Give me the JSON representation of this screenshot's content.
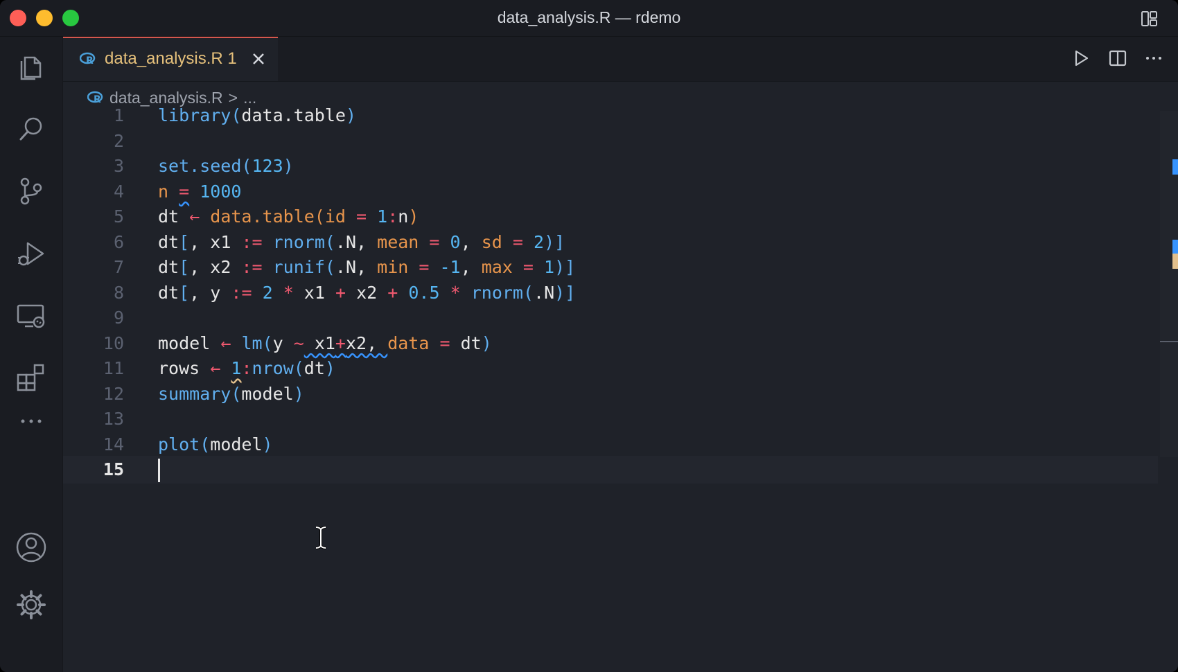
{
  "window": {
    "title": "data_analysis.R — rdemo"
  },
  "activity_bar": {
    "items": [
      "explorer-icon",
      "search-icon",
      "source-control-icon",
      "run-debug-icon",
      "remote-explorer-icon",
      "extensions-icon",
      "more-icon",
      "account-icon",
      "settings-gear-icon"
    ]
  },
  "tab": {
    "label": "data_analysis.R 1",
    "close_icon": "close-icon",
    "accent": "#e5c07b"
  },
  "tab_actions": [
    "run-icon",
    "split-editor-icon",
    "more-actions-icon"
  ],
  "breadcrumb": {
    "file": "data_analysis.R",
    "separator": ">",
    "rest": "..."
  },
  "editor": {
    "current_line": "15",
    "lines": [
      {
        "n": "1"
      },
      {
        "n": "2"
      },
      {
        "n": "3"
      },
      {
        "n": "4"
      },
      {
        "n": "5"
      },
      {
        "n": "6"
      },
      {
        "n": "7"
      },
      {
        "n": "8"
      },
      {
        "n": "9"
      },
      {
        "n": "10"
      },
      {
        "n": "11"
      },
      {
        "n": "12"
      },
      {
        "n": "13"
      },
      {
        "n": "14"
      },
      {
        "n": "15"
      }
    ],
    "code": [
      [
        [
          "fn",
          "library("
        ],
        [
          "id",
          "data.table"
        ],
        [
          "fn",
          ")"
        ]
      ],
      [],
      [
        [
          "fn",
          "set.seed("
        ],
        [
          "num",
          "123"
        ],
        [
          "fn",
          ")"
        ]
      ],
      [
        [
          "var",
          "n "
        ],
        [
          "op",
          "="
        ],
        [
          "id",
          " "
        ],
        [
          "num",
          "1000"
        ]
      ],
      [
        [
          "id",
          "dt "
        ],
        [
          "op",
          "←"
        ],
        [
          "id",
          " "
        ],
        [
          "arg",
          "data.table("
        ],
        [
          "arg",
          "id"
        ],
        [
          "id",
          " "
        ],
        [
          "op",
          "="
        ],
        [
          "id",
          " "
        ],
        [
          "num",
          "1"
        ],
        [
          "op",
          ":"
        ],
        [
          "id",
          "n"
        ],
        [
          "arg",
          ")"
        ]
      ],
      [
        [
          "id",
          "dt"
        ],
        [
          "fn",
          "["
        ],
        [
          "id",
          ", x1 "
        ],
        [
          "op",
          ":="
        ],
        [
          "id",
          " "
        ],
        [
          "fn",
          "rnorm("
        ],
        [
          "id",
          ".N, "
        ],
        [
          "arg",
          "mean"
        ],
        [
          "id",
          " "
        ],
        [
          "op",
          "="
        ],
        [
          "id",
          " "
        ],
        [
          "num",
          "0"
        ],
        [
          "id",
          ", "
        ],
        [
          "arg",
          "sd"
        ],
        [
          "id",
          " "
        ],
        [
          "op",
          "="
        ],
        [
          "id",
          " "
        ],
        [
          "num",
          "2"
        ],
        [
          "fn",
          ")]"
        ]
      ],
      [
        [
          "id",
          "dt"
        ],
        [
          "fn",
          "["
        ],
        [
          "id",
          ", x2 "
        ],
        [
          "op",
          ":="
        ],
        [
          "id",
          " "
        ],
        [
          "fn",
          "runif("
        ],
        [
          "id",
          ".N, "
        ],
        [
          "arg",
          "min"
        ],
        [
          "id",
          " "
        ],
        [
          "op",
          "="
        ],
        [
          "id",
          " "
        ],
        [
          "num",
          "-1"
        ],
        [
          "id",
          ", "
        ],
        [
          "arg",
          "max"
        ],
        [
          "id",
          " "
        ],
        [
          "op",
          "="
        ],
        [
          "id",
          " "
        ],
        [
          "num",
          "1"
        ],
        [
          "fn",
          ")]"
        ]
      ],
      [
        [
          "id",
          "dt"
        ],
        [
          "fn",
          "["
        ],
        [
          "id",
          ", y "
        ],
        [
          "op",
          ":="
        ],
        [
          "id",
          " "
        ],
        [
          "num",
          "2"
        ],
        [
          "id",
          " "
        ],
        [
          "op",
          "*"
        ],
        [
          "id",
          " x1 "
        ],
        [
          "op",
          "+"
        ],
        [
          "id",
          " x2 "
        ],
        [
          "op",
          "+"
        ],
        [
          "id",
          " "
        ],
        [
          "num",
          "0.5"
        ],
        [
          "id",
          " "
        ],
        [
          "op",
          "*"
        ],
        [
          "id",
          " "
        ],
        [
          "fn",
          "rnorm("
        ],
        [
          "id",
          ".N"
        ],
        [
          "fn",
          ")]"
        ]
      ],
      [],
      [
        [
          "id",
          "model "
        ],
        [
          "op",
          "←"
        ],
        [
          "id",
          " "
        ],
        [
          "fn",
          "lm("
        ],
        [
          "id",
          "y "
        ],
        [
          "op",
          "~"
        ],
        [
          "id",
          " x1"
        ],
        [
          "op",
          "+"
        ],
        [
          "id",
          "x2, "
        ],
        [
          "arg",
          "data"
        ],
        [
          "id",
          " "
        ],
        [
          "op",
          "="
        ],
        [
          "id",
          " dt"
        ],
        [
          "fn",
          ")"
        ]
      ],
      [
        [
          "id",
          "rows "
        ],
        [
          "op",
          "←"
        ],
        [
          "id",
          " "
        ],
        [
          "num",
          "1"
        ],
        [
          "op",
          ":"
        ],
        [
          "fn",
          "nrow("
        ],
        [
          "id",
          "dt"
        ],
        [
          "fn",
          ")"
        ]
      ],
      [
        [
          "fn",
          "summary("
        ],
        [
          "id",
          "model"
        ],
        [
          "fn",
          ")"
        ]
      ],
      [],
      [
        [
          "fn",
          "plot("
        ],
        [
          "id",
          "model"
        ],
        [
          "fn",
          ")"
        ]
      ],
      []
    ]
  },
  "overview_ruler": {
    "marks": [
      {
        "color": "#3794ff"
      },
      {
        "color": "#3794ff"
      },
      {
        "color": "#e2c08d"
      }
    ]
  }
}
